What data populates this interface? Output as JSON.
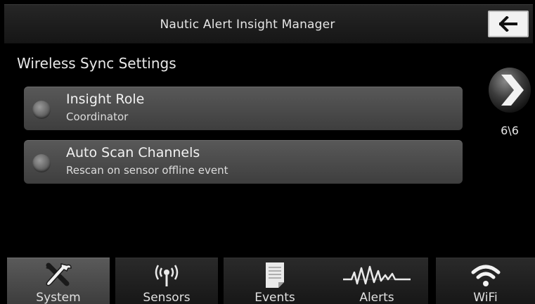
{
  "header": {
    "title": "Nautic Alert Insight Manager",
    "back_icon": "arrow-left-icon"
  },
  "section": {
    "title": "Wireless Sync Settings"
  },
  "items": [
    {
      "label": "Insight Role",
      "value": "Coordinator"
    },
    {
      "label": "Auto Scan Channels",
      "value": "Rescan on sensor offline event"
    }
  ],
  "pager": {
    "indicator": "6\\6",
    "next_icon": "chevron-right-icon"
  },
  "nav": {
    "active": "System",
    "tabs": [
      {
        "label": "System",
        "icon": "tools-icon"
      },
      {
        "label": "Sensors",
        "icon": "antenna-icon"
      },
      {
        "label": "Events",
        "icon": "document-icon"
      },
      {
        "label": "Alerts",
        "icon": "waveform-icon"
      },
      {
        "label": "WiFi",
        "icon": "wifi-icon"
      }
    ]
  },
  "colors": {
    "background": "#000000",
    "active_tab": "#4a4a4a",
    "item_bg": "#4f4f4f"
  }
}
